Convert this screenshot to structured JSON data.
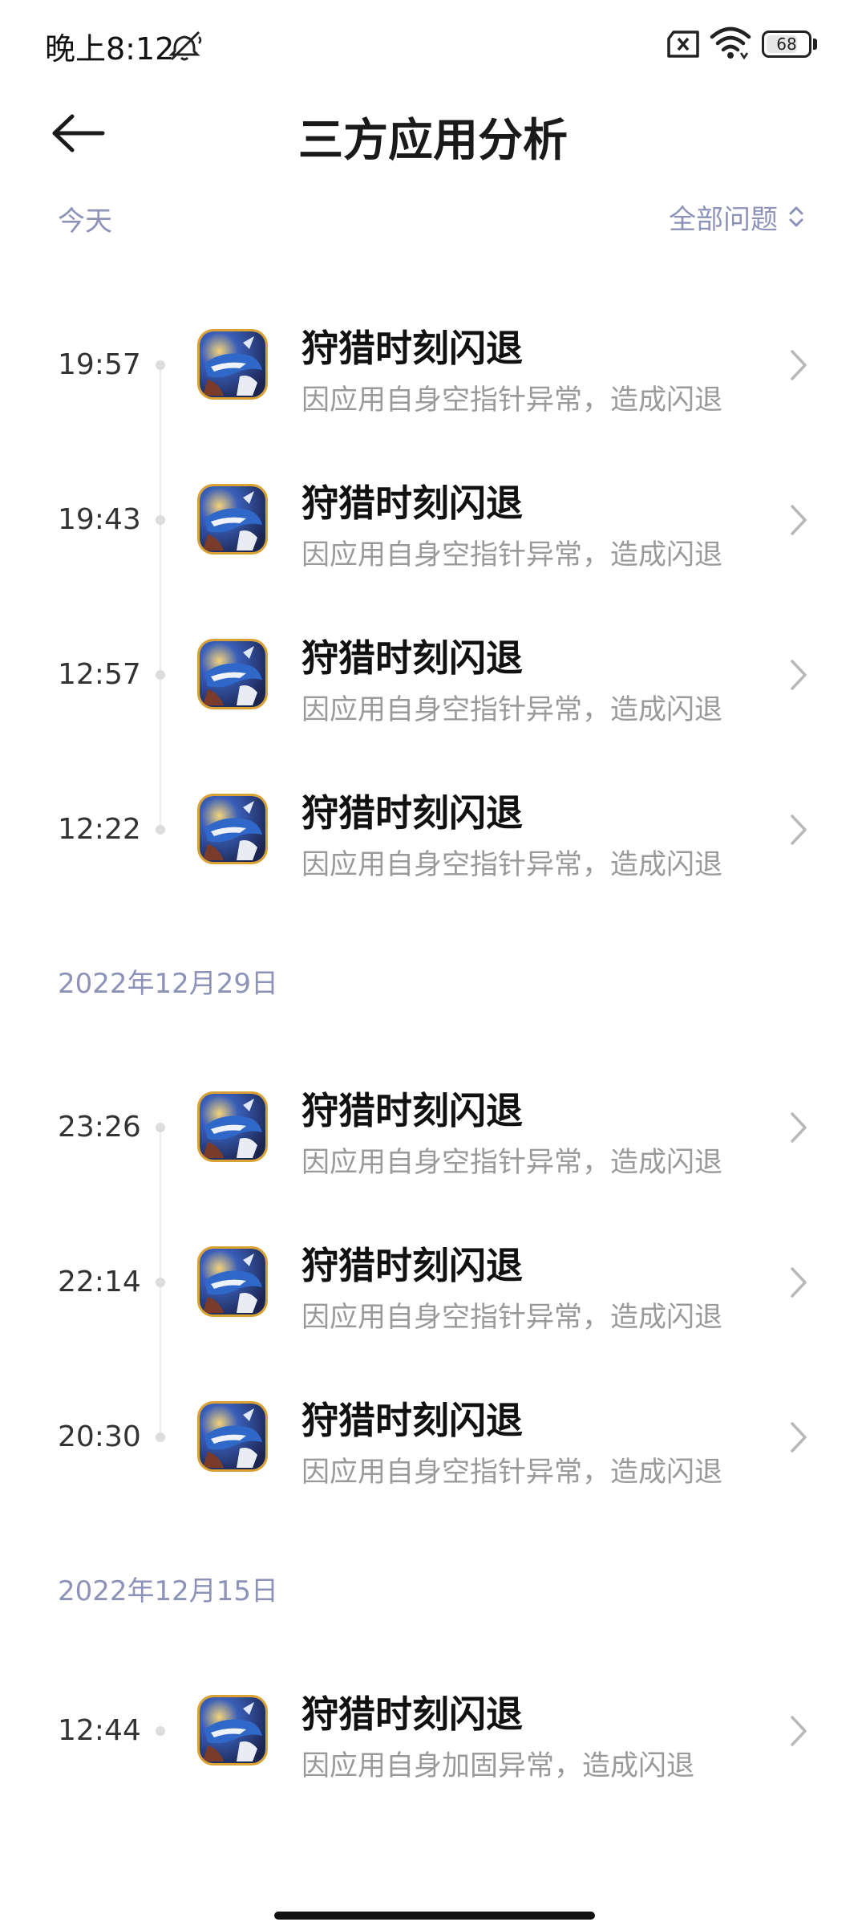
{
  "status_bar": {
    "time": "晚上8:12",
    "battery": "68",
    "battery_level_percent": 68,
    "icons": [
      "mute-icon",
      "sim-error-icon",
      "wifi-icon",
      "battery-icon"
    ]
  },
  "header": {
    "title": "三方应用分析",
    "back_icon": "back-arrow-icon"
  },
  "filter": {
    "section_label": "今天",
    "dropdown_label": "全部问题"
  },
  "sections": [
    {
      "label": "今天",
      "items": [
        {
          "time": "19:57",
          "title": "狩猎时刻闪退",
          "desc": "因应用自身空指针异常，造成闪退"
        },
        {
          "time": "19:43",
          "title": "狩猎时刻闪退",
          "desc": "因应用自身空指针异常，造成闪退"
        },
        {
          "time": "12:57",
          "title": "狩猎时刻闪退",
          "desc": "因应用自身空指针异常，造成闪退"
        },
        {
          "time": "12:22",
          "title": "狩猎时刻闪退",
          "desc": "因应用自身空指针异常，造成闪退"
        }
      ]
    },
    {
      "label": "2022年12月29日",
      "items": [
        {
          "time": "23:26",
          "title": "狩猎时刻闪退",
          "desc": "因应用自身空指针异常，造成闪退"
        },
        {
          "time": "22:14",
          "title": "狩猎时刻闪退",
          "desc": "因应用自身空指针异常，造成闪退"
        },
        {
          "time": "20:30",
          "title": "狩猎时刻闪退",
          "desc": "因应用自身空指针异常，造成闪退"
        }
      ]
    },
    {
      "label": "2022年12月15日",
      "items": [
        {
          "time": "12:44",
          "title": "狩猎时刻闪退",
          "desc": "因应用自身加固异常，造成闪退"
        }
      ]
    }
  ],
  "colors": {
    "section_label": "#8d93b8",
    "title": "#111111",
    "desc": "#9a9a9a",
    "icon_border": "#d9a233"
  }
}
